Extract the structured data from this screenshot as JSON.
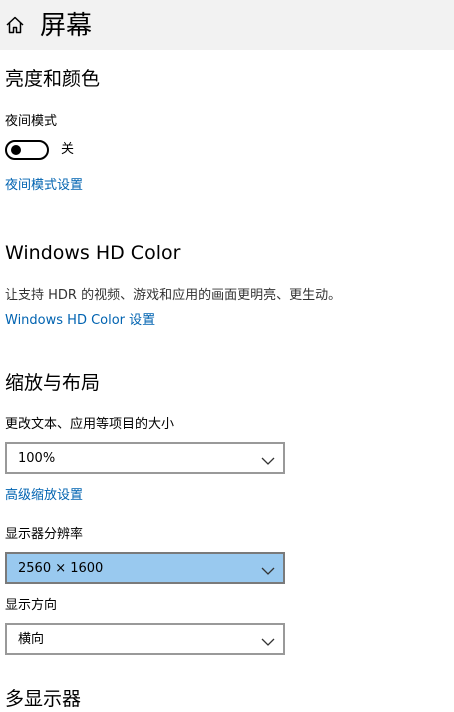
{
  "header": {
    "title": "屏幕",
    "home_icon": "home-icon"
  },
  "brightness_color": {
    "title": "亮度和颜色",
    "night_light_label": "夜间模式",
    "night_light_state": "关",
    "night_light_on": false,
    "night_light_settings_link": "夜间模式设置"
  },
  "hd_color": {
    "title": "Windows HD Color",
    "description": "让支持 HDR 的视频、游戏和应用的画面更明亮、更生动。",
    "settings_link": "Windows HD Color 设置"
  },
  "scale_layout": {
    "title": "缩放与布局",
    "scale_label": "更改文本、应用等项目的大小",
    "scale_value": "100%",
    "advanced_scaling_link": "高级缩放设置",
    "resolution_label": "显示器分辨率",
    "resolution_value": "2560 × 1600",
    "orientation_label": "显示方向",
    "orientation_value": "横向"
  },
  "multiple_displays": {
    "title": "多显示器"
  },
  "colors": {
    "link": "#0063b1",
    "header_bg": "#f2f2f2",
    "selected_dropdown_bg": "#99c9ef"
  }
}
